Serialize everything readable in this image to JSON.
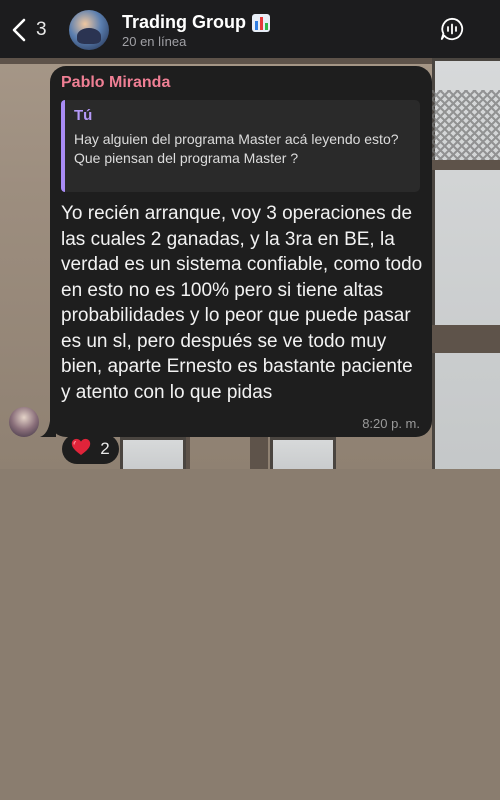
{
  "header": {
    "back_count": "3",
    "title": "Trading Group",
    "status": "20 en línea"
  },
  "message": {
    "sender": "Pablo Miranda",
    "quote": {
      "author": "Tú",
      "text": "Hay alguien del programa Master acá leyendo esto?\nQue piensan del programa Master ?"
    },
    "text": "Yo recién arranque, voy 3 operaciones de las cuales 2 ganadas, y la 3ra en BE, la verdad es un sistema confiable, como todo en esto no es 100% pero si tiene altas probabilidades y lo peor que puede pasar es un sl, pero después se ve todo muy bien, aparte Ernesto es bastante paciente y atento con lo que pidas",
    "time": "8:20 p. m.",
    "reaction": {
      "emoji_icon": "red-heart-icon",
      "count": "2"
    }
  },
  "colors": {
    "header_bg": "#1c1c1e",
    "bubble_bg": "#1e1e1e",
    "sender_color": "#ef7f94",
    "quote_accent": "#a98cf5",
    "heart": "#e0243a"
  }
}
